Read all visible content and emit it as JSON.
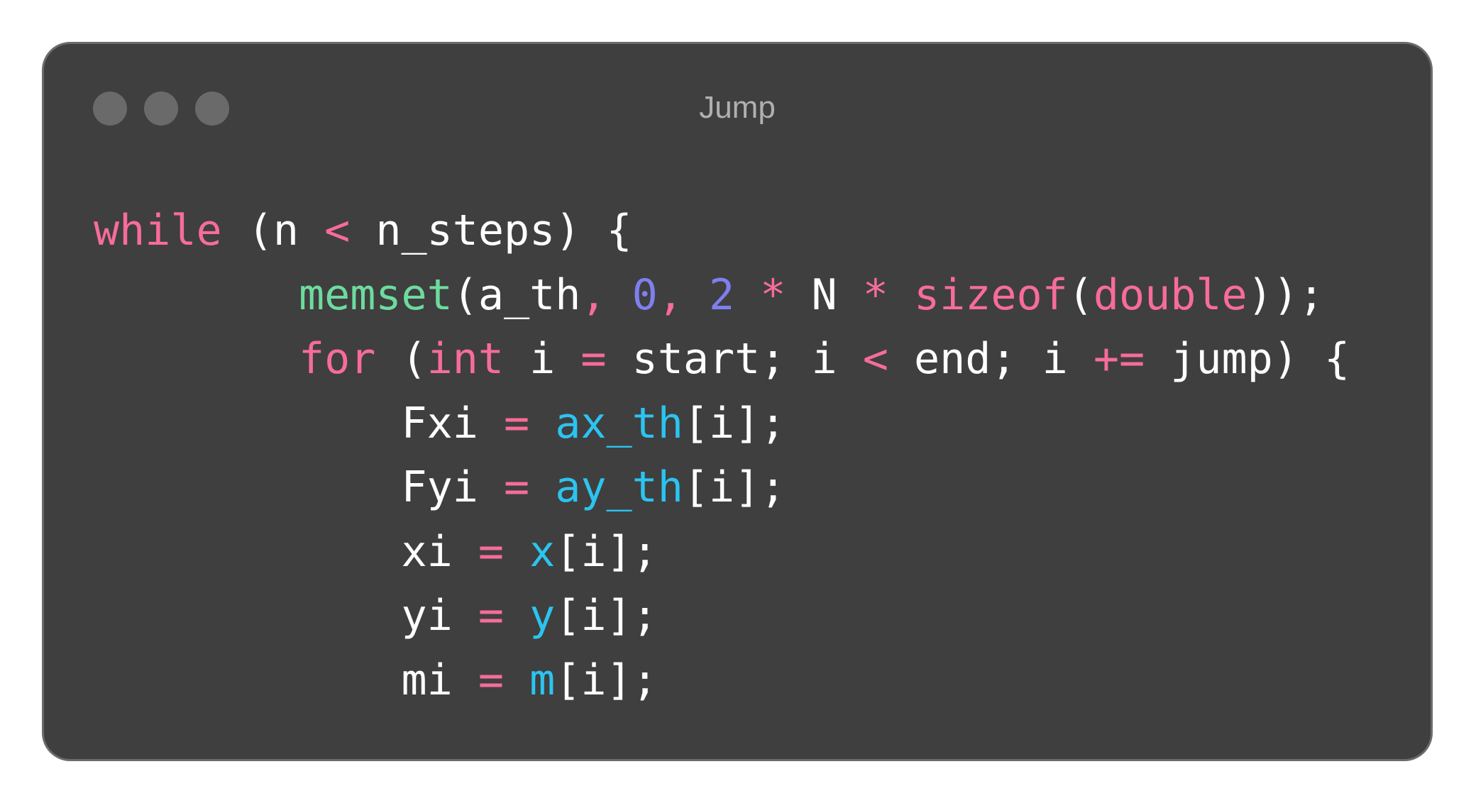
{
  "window": {
    "title": "Jump",
    "controls": [
      "close-dot",
      "minimize-dot",
      "zoom-dot"
    ]
  },
  "colors": {
    "background": "#3f3f3f",
    "keyword": "#f76c9a",
    "function": "#6ddb9e",
    "number": "#7f7ff0",
    "member": "#2bc4f0",
    "plain": "#ffffff",
    "title": "#b0b0b0"
  },
  "code": {
    "language": "c",
    "lines": [
      [
        {
          "t": "while",
          "k": "keyword"
        },
        {
          "t": " (n ",
          "k": "plain"
        },
        {
          "t": "<",
          "k": "operator"
        },
        {
          "t": " n_steps) {",
          "k": "plain"
        }
      ],
      [
        {
          "t": "        ",
          "k": "plain"
        },
        {
          "t": "memset",
          "k": "function"
        },
        {
          "t": "(a_th",
          "k": "plain"
        },
        {
          "t": ", ",
          "k": "operator"
        },
        {
          "t": "0",
          "k": "number"
        },
        {
          "t": ", ",
          "k": "operator"
        },
        {
          "t": "2",
          "k": "number"
        },
        {
          "t": " * ",
          "k": "operator"
        },
        {
          "t": "N",
          "k": "plain"
        },
        {
          "t": " * ",
          "k": "operator"
        },
        {
          "t": "sizeof",
          "k": "keyword"
        },
        {
          "t": "(",
          "k": "plain"
        },
        {
          "t": "double",
          "k": "type"
        },
        {
          "t": "));",
          "k": "plain"
        }
      ],
      [
        {
          "t": "        ",
          "k": "plain"
        },
        {
          "t": "for",
          "k": "keyword"
        },
        {
          "t": " (",
          "k": "plain"
        },
        {
          "t": "int",
          "k": "type"
        },
        {
          "t": " i ",
          "k": "plain"
        },
        {
          "t": "=",
          "k": "operator"
        },
        {
          "t": " start; i ",
          "k": "plain"
        },
        {
          "t": "<",
          "k": "operator"
        },
        {
          "t": " end; i ",
          "k": "plain"
        },
        {
          "t": "+=",
          "k": "operator"
        },
        {
          "t": " jump) {",
          "k": "plain"
        }
      ],
      [
        {
          "t": "            Fxi ",
          "k": "plain"
        },
        {
          "t": "=",
          "k": "operator"
        },
        {
          "t": " ",
          "k": "plain"
        },
        {
          "t": "ax_th",
          "k": "member"
        },
        {
          "t": "[i];",
          "k": "plain"
        }
      ],
      [
        {
          "t": "            Fyi ",
          "k": "plain"
        },
        {
          "t": "=",
          "k": "operator"
        },
        {
          "t": " ",
          "k": "plain"
        },
        {
          "t": "ay_th",
          "k": "member"
        },
        {
          "t": "[i];",
          "k": "plain"
        }
      ],
      [
        {
          "t": "            xi ",
          "k": "plain"
        },
        {
          "t": "=",
          "k": "operator"
        },
        {
          "t": " ",
          "k": "plain"
        },
        {
          "t": "x",
          "k": "member"
        },
        {
          "t": "[i];",
          "k": "plain"
        }
      ],
      [
        {
          "t": "            yi ",
          "k": "plain"
        },
        {
          "t": "=",
          "k": "operator"
        },
        {
          "t": " ",
          "k": "plain"
        },
        {
          "t": "y",
          "k": "member"
        },
        {
          "t": "[i];",
          "k": "plain"
        }
      ],
      [
        {
          "t": "            mi ",
          "k": "plain"
        },
        {
          "t": "=",
          "k": "operator"
        },
        {
          "t": " ",
          "k": "plain"
        },
        {
          "t": "m",
          "k": "member"
        },
        {
          "t": "[i];",
          "k": "plain"
        }
      ]
    ]
  }
}
